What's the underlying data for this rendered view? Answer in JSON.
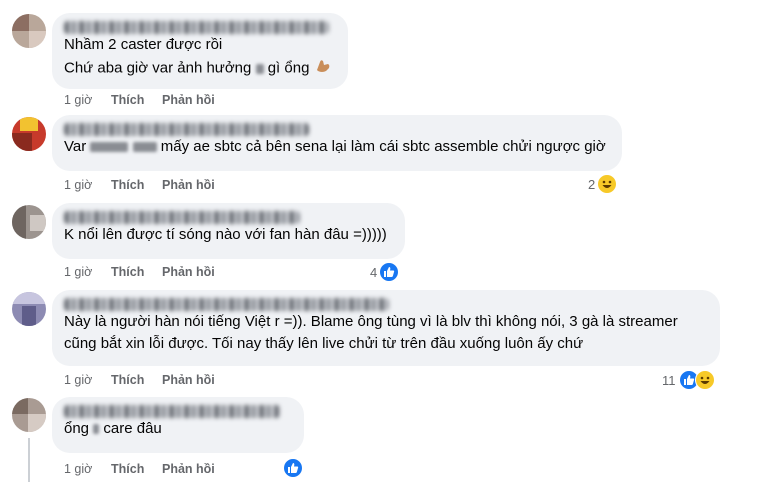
{
  "actions": {
    "time": "1 giờ",
    "like": "Thích",
    "reply": "Phản hồi"
  },
  "comments": [
    {
      "lines": [
        "Nhầm 2 caster được rồi",
        "Chứ aba giờ var ảnh hưởng",
        "gì ổng"
      ],
      "reaction_count": "",
      "reactions": []
    },
    {
      "lines": [
        "Var",
        "mấy ae sbtc cả bên sena lại làm cái sbtc assemble chửi ngược giờ"
      ],
      "reaction_count": "2",
      "reactions": [
        "haha-icon"
      ]
    },
    {
      "lines": [
        "K nổi lên được tí sóng nào với fan hàn đâu =)))))"
      ],
      "reaction_count": "4",
      "reactions": [
        "like-icon"
      ]
    },
    {
      "lines": [
        "Này là người hàn nói tiếng Việt r =)). Blame ông tùng vì là blv thì không nói, 3 gà là streamer",
        "cũng bắt xin lỗi được. Tối nay thấy lên live chửi từ trên đầu xuống luôn ấy chứ"
      ],
      "reaction_count": "11",
      "reactions": [
        "like-icon",
        "haha-icon"
      ]
    },
    {
      "lines": [
        "ổng",
        "care đâu"
      ],
      "reaction_count": "",
      "reactions": [
        "like-icon"
      ]
    }
  ],
  "colors": {
    "bubble": "#f0f2f5",
    "meta": "#65676b",
    "like_blue": "#1877f2",
    "haha_yellow": "#f7c928"
  }
}
